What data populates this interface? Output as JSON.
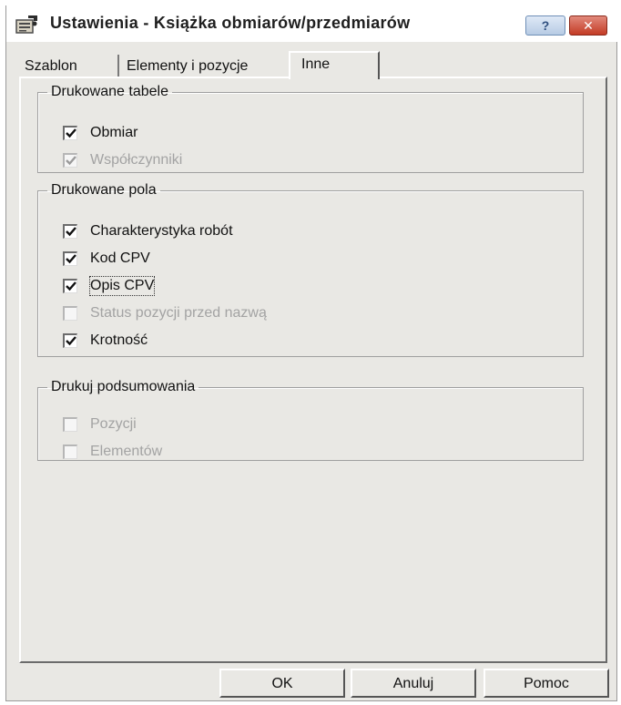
{
  "window": {
    "title": "Ustawienia - Książka obmiarów/przedmiarów",
    "icon": "settings-properties-icon",
    "help_button_label": "?",
    "close_button_label": "✕"
  },
  "tabs": [
    {
      "label": "Szablon",
      "active": false
    },
    {
      "label": "Elementy i pozycje",
      "active": false
    },
    {
      "label": "Inne",
      "active": true
    }
  ],
  "groups": {
    "printed_tables": {
      "legend": "Drukowane tabele",
      "items": [
        {
          "label": "Obmiar",
          "checked": true,
          "enabled": true
        },
        {
          "label": "Współczynniki",
          "checked": true,
          "enabled": false
        }
      ]
    },
    "printed_fields": {
      "legend": "Drukowane pola",
      "items": [
        {
          "label": "Charakterystyka robót",
          "checked": true,
          "enabled": true
        },
        {
          "label": "Kod CPV",
          "checked": true,
          "enabled": true
        },
        {
          "label": "Opis CPV",
          "checked": true,
          "enabled": true,
          "focused": true
        },
        {
          "label": "Status pozycji przed nazwą",
          "checked": false,
          "enabled": false
        },
        {
          "label": "Krotność",
          "checked": true,
          "enabled": true
        }
      ]
    },
    "print_summaries": {
      "legend": "Drukuj podsumowania",
      "items": [
        {
          "label": "Pozycji",
          "checked": false,
          "enabled": false
        },
        {
          "label": "Elementów",
          "checked": false,
          "enabled": false
        }
      ]
    }
  },
  "buttons": {
    "ok": "OK",
    "cancel": "Anuluj",
    "help": "Pomoc"
  }
}
